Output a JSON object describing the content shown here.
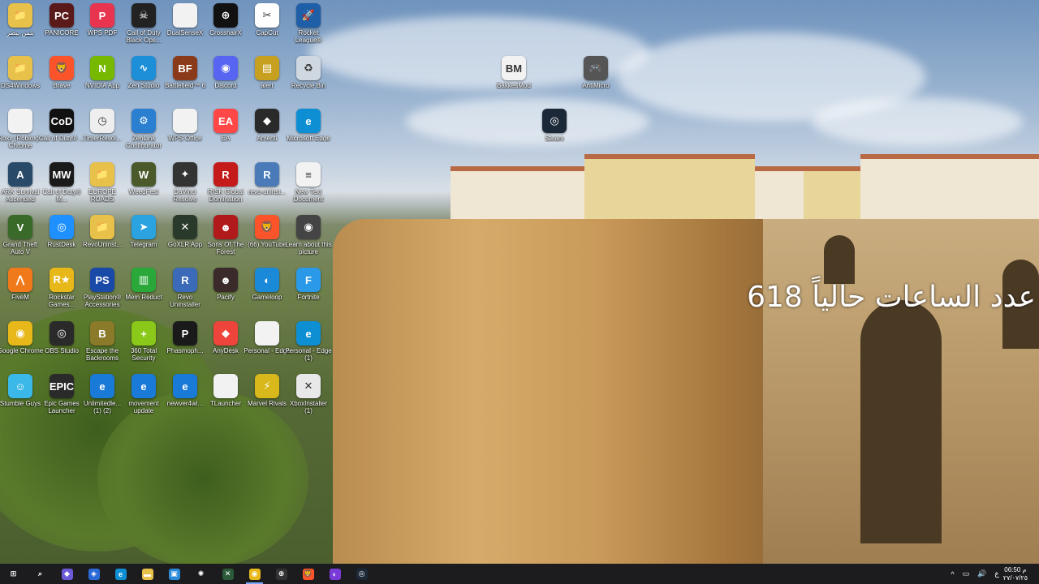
{
  "desktop": {
    "counter_text": "عدد الساعات حالياً 618",
    "icons": [
      {
        "id": "folder-1",
        "label": "بتمن بيصر",
        "glyph": "📁",
        "color": "#e8c14a"
      },
      {
        "id": "panicore",
        "label": "PANICORE",
        "glyph": "PC",
        "color": "#5a1a1a"
      },
      {
        "id": "wps-pdf",
        "label": "WPS PDF",
        "glyph": "P",
        "color": "#e8344e"
      },
      {
        "id": "cod-bo",
        "label": "Call of Duty Black Ops...",
        "glyph": "☠",
        "color": "#222"
      },
      {
        "id": "dualsensex",
        "label": "DualSenseX",
        "glyph": "",
        "color": "#f2f2f2"
      },
      {
        "id": "crosshairx",
        "label": "CrosshairX",
        "glyph": "⊕",
        "color": "#111"
      },
      {
        "id": "capcut",
        "label": "CapCut",
        "glyph": "✂",
        "color": "#fff"
      },
      {
        "id": "rocket-league",
        "label": "Rocket League®",
        "glyph": "🚀",
        "color": "#1e5fa8"
      },
      {
        "id": "ds4windows",
        "label": "DS4Windows",
        "glyph": "📁",
        "color": "#e8c14a"
      },
      {
        "id": "brave",
        "label": "Brave",
        "glyph": "🦁",
        "color": "#fb542b"
      },
      {
        "id": "nvidia-app",
        "label": "NVIDIA App",
        "glyph": "N",
        "color": "#76b900"
      },
      {
        "id": "zen-studio",
        "label": "Zen Studio",
        "glyph": "∿",
        "color": "#1d8ed8"
      },
      {
        "id": "battlefield-6",
        "label": "Battlefield™ 6",
        "glyph": "BF",
        "color": "#8a3a18"
      },
      {
        "id": "discord",
        "label": "Discord",
        "glyph": "◉",
        "color": "#5865f2"
      },
      {
        "id": "alert",
        "label": "alert",
        "glyph": "▤",
        "color": "#c8a020"
      },
      {
        "id": "recycle-bin",
        "label": "Recycle Bin",
        "glyph": "♻",
        "color": "#cfd8e0"
      },
      {
        "id": "roxx",
        "label": "Roxx (Roblox) - Chrome",
        "glyph": "",
        "color": "#f2f2f2"
      },
      {
        "id": "cod-2",
        "label": "Call of Duty® ...",
        "glyph": "CoD",
        "color": "#111"
      },
      {
        "id": "timerresolution",
        "label": "TimerResol...",
        "glyph": "◷",
        "color": "#eee"
      },
      {
        "id": "zenlink",
        "label": "ZenLink Configurator",
        "glyph": "⚙",
        "color": "#2a7fd0"
      },
      {
        "id": "wps-office",
        "label": "WPS Office",
        "glyph": "",
        "color": "#f2f2f2"
      },
      {
        "id": "ea",
        "label": "EA",
        "glyph": "EA",
        "color": "#ff4747"
      },
      {
        "id": "amenti",
        "label": "Amenti",
        "glyph": "◆",
        "color": "#2a2a2a"
      },
      {
        "id": "ms-edge",
        "label": "Microsoft Edge",
        "glyph": "e",
        "color": "#0e8fd4"
      },
      {
        "id": "ark",
        "label": "ARK Survival Ascended",
        "glyph": "A",
        "color": "#2a4a6a"
      },
      {
        "id": "cod-mw",
        "label": "Call of Duty® M...",
        "glyph": "MW",
        "color": "#1a1a1a"
      },
      {
        "id": "europe-roads",
        "label": "EUROPE ROADS",
        "glyph": "📁",
        "color": "#e8c14a"
      },
      {
        "id": "weedfest",
        "label": "WeedFest",
        "glyph": "W",
        "color": "#4a5a2a"
      },
      {
        "id": "davinci",
        "label": "DaVinci Resolve",
        "glyph": "✦",
        "color": "#333"
      },
      {
        "id": "risk",
        "label": "RISK Global Domination",
        "glyph": "R",
        "color": "#c41a1a"
      },
      {
        "id": "revo-uninst",
        "label": "revo-uninst...",
        "glyph": "R",
        "color": "#4a7ab8"
      },
      {
        "id": "new-text",
        "label": "New Text Document",
        "glyph": "≡",
        "color": "#f2f2f2"
      },
      {
        "id": "gta-v",
        "label": "Grand Theft Auto V",
        "glyph": "V",
        "color": "#3a6a2a"
      },
      {
        "id": "rustdesk",
        "label": "RustDesk",
        "glyph": "◎",
        "color": "#1e90ff"
      },
      {
        "id": "revouninst-2",
        "label": "RevoUninst...",
        "glyph": "📁",
        "color": "#e8c14a"
      },
      {
        "id": "telegram",
        "label": "Telegram",
        "glyph": "➤",
        "color": "#2aa3e0"
      },
      {
        "id": "goxlr",
        "label": "GoXLR App",
        "glyph": "✕",
        "color": "#2a3a2a"
      },
      {
        "id": "sons-forest",
        "label": "Sons Of The Forest",
        "glyph": "☻",
        "color": "#b01a1a"
      },
      {
        "id": "youtube",
        "label": "(66) YouTube",
        "glyph": "🦁",
        "color": "#fb542b"
      },
      {
        "id": "learn-picture",
        "label": "Learn about this picture",
        "glyph": "◉",
        "color": "#444"
      },
      {
        "id": "fivem",
        "label": "FiveM",
        "glyph": "⋀",
        "color": "#f07a1a"
      },
      {
        "id": "rockstar",
        "label": "Rockstar Games...",
        "glyph": "R★",
        "color": "#e8b81a"
      },
      {
        "id": "ps-accessories",
        "label": "PlayStation® Accessories",
        "glyph": "PS",
        "color": "#1a4aa8"
      },
      {
        "id": "mem-reduct",
        "label": "Mem Reduct",
        "glyph": "▥",
        "color": "#2aa83a"
      },
      {
        "id": "revo-uninstaller",
        "label": "Revo Uninstaller",
        "glyph": "R",
        "color": "#3a6ab8"
      },
      {
        "id": "pacify",
        "label": "Pacify",
        "glyph": "☻",
        "color": "#3a2a2a"
      },
      {
        "id": "gameloop",
        "label": "Gameloop",
        "glyph": "◐",
        "color": "#1a8ad8"
      },
      {
        "id": "fortnite",
        "label": "Fortnite",
        "glyph": "F",
        "color": "#2a9ae8"
      },
      {
        "id": "chrome",
        "label": "Google Chrome",
        "glyph": "◉",
        "color": "#e8b81a"
      },
      {
        "id": "obs",
        "label": "OBS Studio",
        "glyph": "◎",
        "color": "#2a2a2a"
      },
      {
        "id": "escape-backrooms",
        "label": "Escape the Backrooms",
        "glyph": "B",
        "color": "#8a7a2a"
      },
      {
        "id": "360-security",
        "label": "360 Total Security",
        "glyph": "+",
        "color": "#8ac81a"
      },
      {
        "id": "phasmophobia",
        "label": "Phasmoph...",
        "glyph": "P",
        "color": "#1a1a1a"
      },
      {
        "id": "anydesk",
        "label": "AnyDesk",
        "glyph": "◆",
        "color": "#ef443b"
      },
      {
        "id": "personal-edge",
        "label": "Personal - Edge",
        "glyph": "",
        "color": "#f2f2f2"
      },
      {
        "id": "personal-edge-1",
        "label": "Personal - Edge (1)",
        "glyph": "e",
        "color": "#0e8fd4"
      },
      {
        "id": "stumble-guys",
        "label": "Stumble Guys",
        "glyph": "☺",
        "color": "#3ab8e8"
      },
      {
        "id": "epic",
        "label": "Epic Games Launcher",
        "glyph": "EPIC",
        "color": "#2a2a2a"
      },
      {
        "id": "unlimited",
        "label": "Unlimitedle... (1) (2)",
        "glyph": "e",
        "color": "#1a7ad8"
      },
      {
        "id": "movement-update",
        "label": "movement update",
        "glyph": "e",
        "color": "#1a7ad8"
      },
      {
        "id": "newver4",
        "label": "newver4wi...",
        "glyph": "e",
        "color": "#1a7ad8"
      },
      {
        "id": "tlauncher",
        "label": "TLauncher",
        "glyph": "",
        "color": "#f2f2f2"
      },
      {
        "id": "marvel-rivals",
        "label": "Marvel Rivals",
        "glyph": "⚡",
        "color": "#d8b81a"
      },
      {
        "id": "xbox-installer",
        "label": "XboxInstaller (1)",
        "glyph": "✕",
        "color": "#e8e8e8"
      },
      {
        "id": "bakkesmod",
        "label": "BakkesMod",
        "glyph": "BM",
        "color": "#f2f2f2"
      },
      {
        "id": "antimicro",
        "label": "AntiMicro",
        "glyph": "🎮",
        "color": "#555"
      },
      {
        "id": "steam",
        "label": "Steam",
        "glyph": "◎",
        "color": "#1b2838"
      }
    ]
  },
  "taskbar": {
    "items": [
      {
        "id": "start",
        "glyph": "⊞",
        "color": "#1c1c1f"
      },
      {
        "id": "search",
        "glyph": "⌕",
        "color": "#1c1c1f"
      },
      {
        "id": "copilot",
        "glyph": "◆",
        "color": "#6a5ad8"
      },
      {
        "id": "app-store",
        "glyph": "◈",
        "color": "#2a6ad8"
      },
      {
        "id": "edge",
        "glyph": "e",
        "color": "#0e8fd4"
      },
      {
        "id": "file-explorer",
        "glyph": "▬",
        "color": "#e8c14a"
      },
      {
        "id": "ms-store",
        "glyph": "▣",
        "color": "#2a8ad8"
      },
      {
        "id": "chatgpt",
        "glyph": "✺",
        "color": "#1c1c1f"
      },
      {
        "id": "goxlr-tb",
        "glyph": "✕",
        "color": "#2a5a3a"
      },
      {
        "id": "chrome-tb",
        "glyph": "◉",
        "color": "#e8b81a"
      },
      {
        "id": "crosshair-tb",
        "glyph": "⊕",
        "color": "#333"
      },
      {
        "id": "brave-tb",
        "glyph": "🦁",
        "color": "#fb542b"
      },
      {
        "id": "gameloop-tb",
        "glyph": "◐",
        "color": "#7a3ad8"
      },
      {
        "id": "steam-tb",
        "glyph": "◎",
        "color": "#1b2838"
      }
    ],
    "tray": {
      "chevron": "^",
      "keyboard_lang": "ع",
      "time": "06:50 م",
      "date": "٢٧/٠٧/٢٥"
    }
  }
}
